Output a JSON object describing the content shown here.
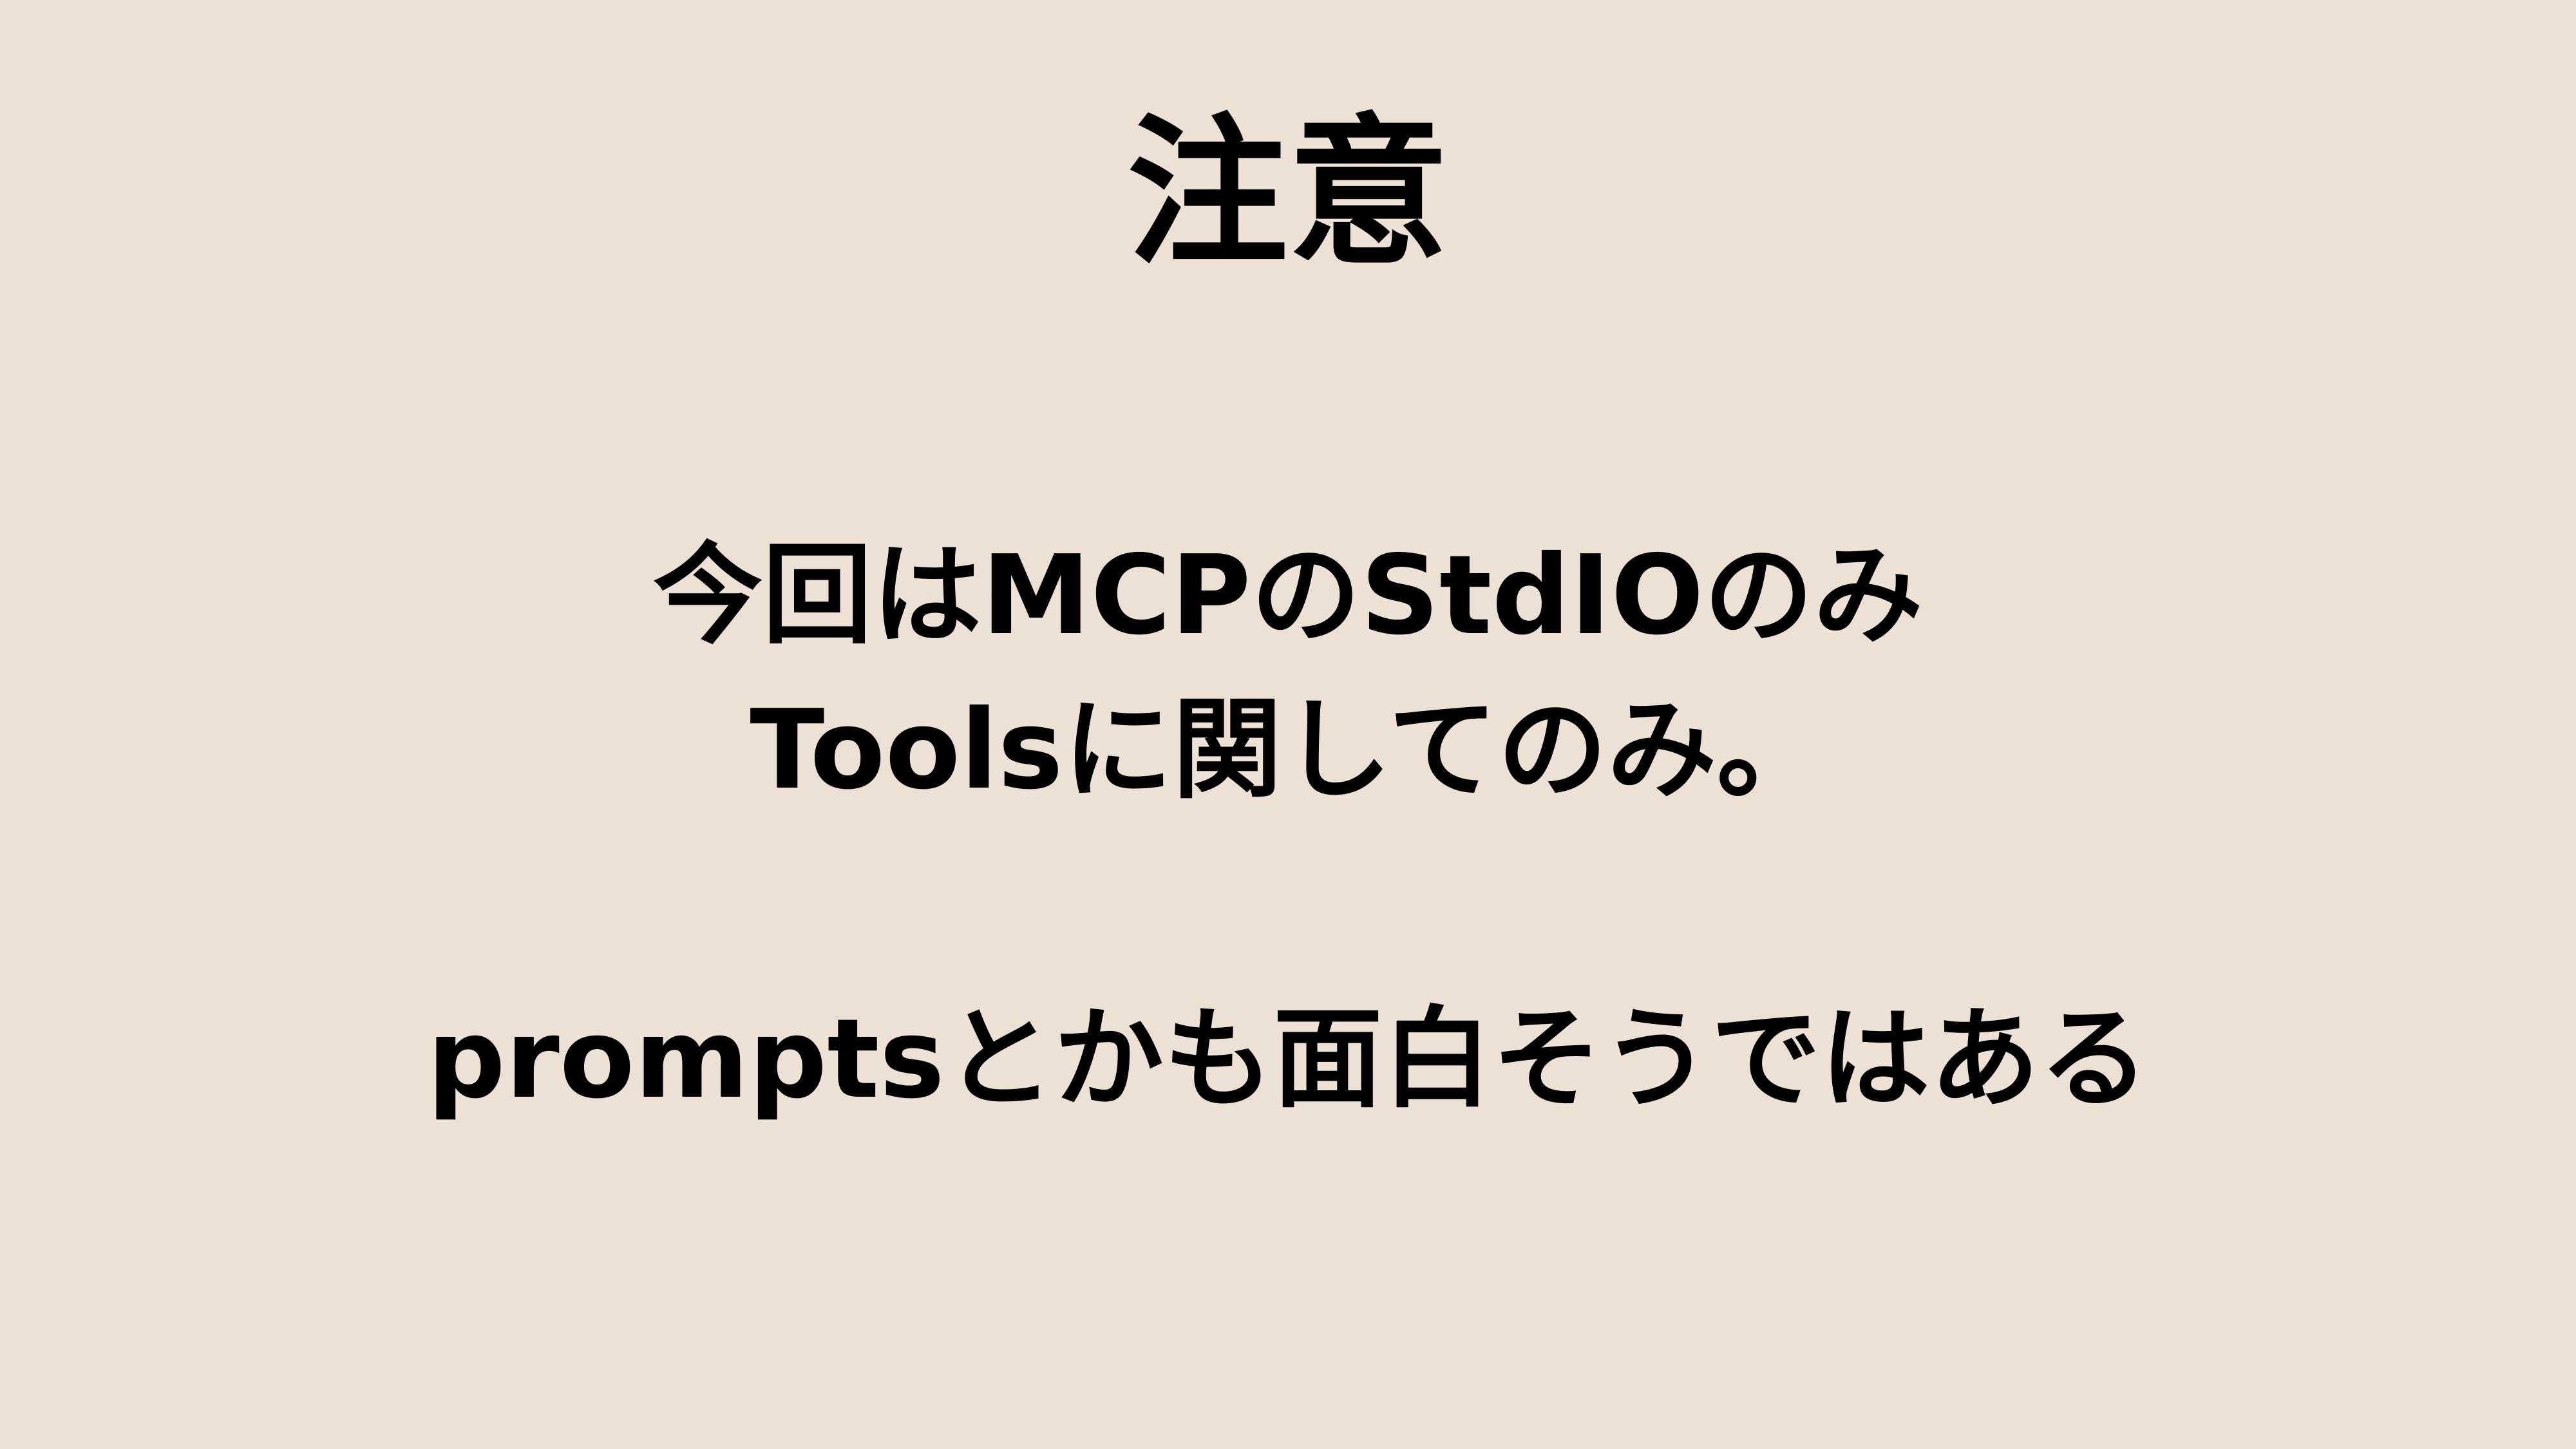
{
  "slide": {
    "title": "注意",
    "lines": [
      "今回はMCPのStdIOのみ",
      "Toolsに関してのみ。",
      "promptsとかも面白そうではある"
    ],
    "colors": {
      "background": "#ede1d6",
      "text": "#000000"
    }
  }
}
